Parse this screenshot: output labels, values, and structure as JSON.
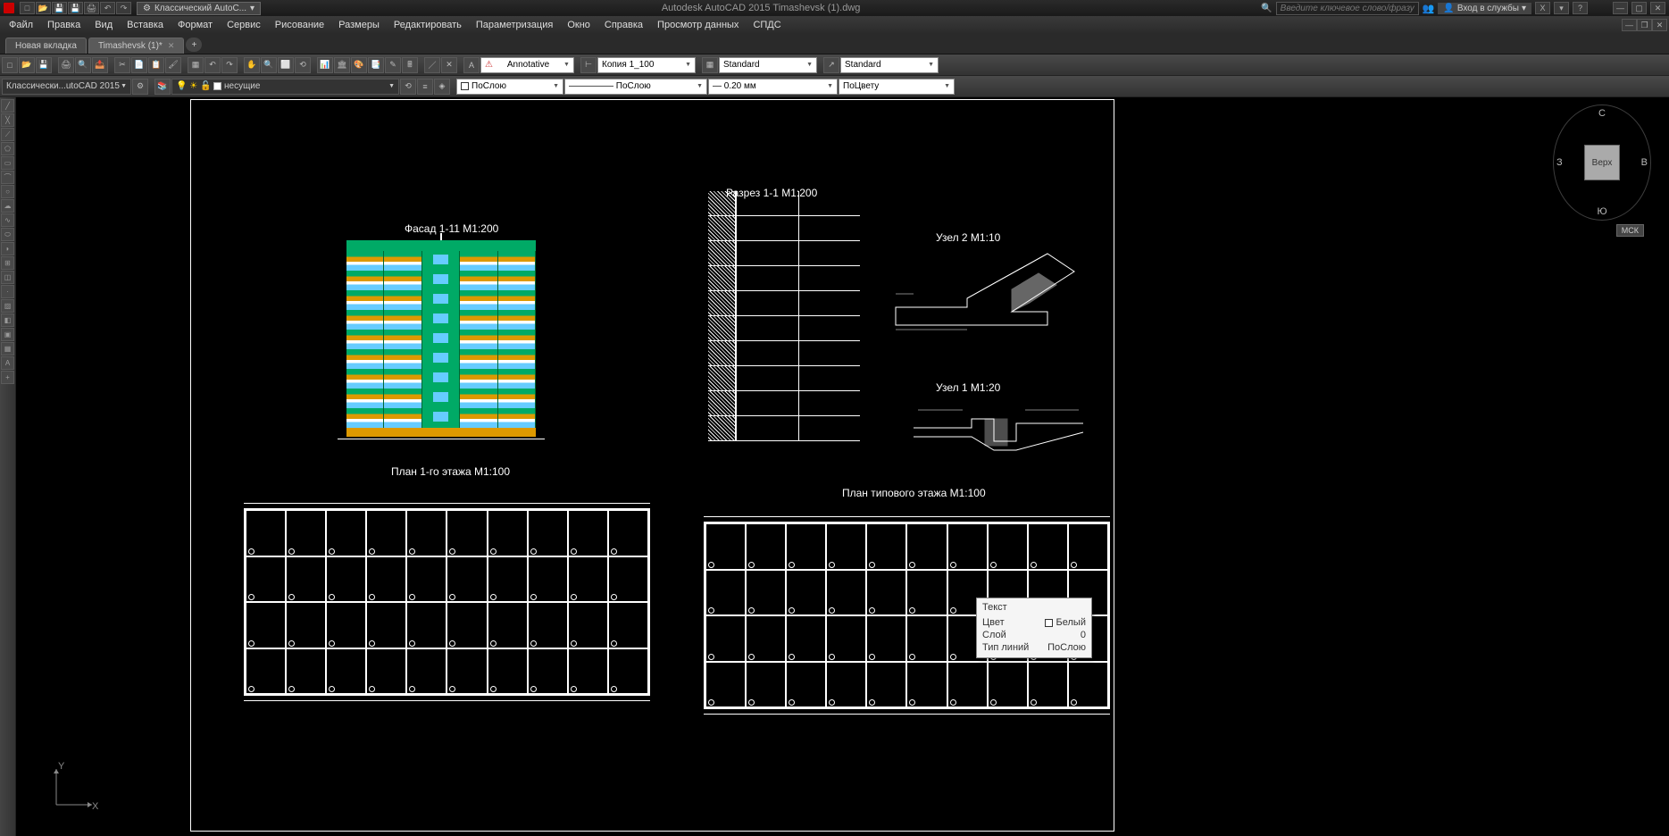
{
  "app": {
    "title": "Autodesk AutoCAD 2015   Timashevsk (1).dwg",
    "workspace_dd": "Классический AutoC...",
    "search_placeholder": "Введите ключевое слово/фразу",
    "login_label": "Вход в службы"
  },
  "menu": [
    "Файл",
    "Правка",
    "Вид",
    "Вставка",
    "Формат",
    "Сервис",
    "Рисование",
    "Размеры",
    "Редактировать",
    "Параметризация",
    "Окно",
    "Справка",
    "Просмотр данных",
    "СПДС"
  ],
  "tabs": [
    {
      "label": "Новая вкладка",
      "active": false,
      "closable": false
    },
    {
      "label": "Timashevsk (1)*",
      "active": true,
      "closable": true
    }
  ],
  "toolbar2": {
    "annotative": "Annotative",
    "scale": "Копия 1_100",
    "textstyle": "Standard",
    "dimstyle": "Standard"
  },
  "toolbar3": {
    "workspace": "Классически...utoCAD 2015",
    "layer": "несущие",
    "colorby": "ПоСлою",
    "ltby": "ПоСлою",
    "lw": "0.20 мм",
    "plotby": "ПоЦвету"
  },
  "canvas_labels": {
    "facade": "Фасад 1-11 М1:200",
    "section": "Разрез 1-1 М1:200",
    "node2": "Узел 2 М1:10",
    "node1": "Узел 1 М1:20",
    "plan1": "План 1-го этажа М1:100",
    "plan2": "План типового этажа М1:100"
  },
  "tooltip": {
    "title": "Текст",
    "rows": [
      {
        "k": "Цвет",
        "v": "Белый"
      },
      {
        "k": "Слой",
        "v": "0"
      },
      {
        "k": "Тип линий",
        "v": "ПоСлою"
      }
    ]
  },
  "viewcube": {
    "face": "Верх",
    "n": "С",
    "s": "Ю",
    "w": "З",
    "e": "В",
    "wcs": "МСК"
  },
  "ucs": {
    "x": "X",
    "y": "Y"
  }
}
